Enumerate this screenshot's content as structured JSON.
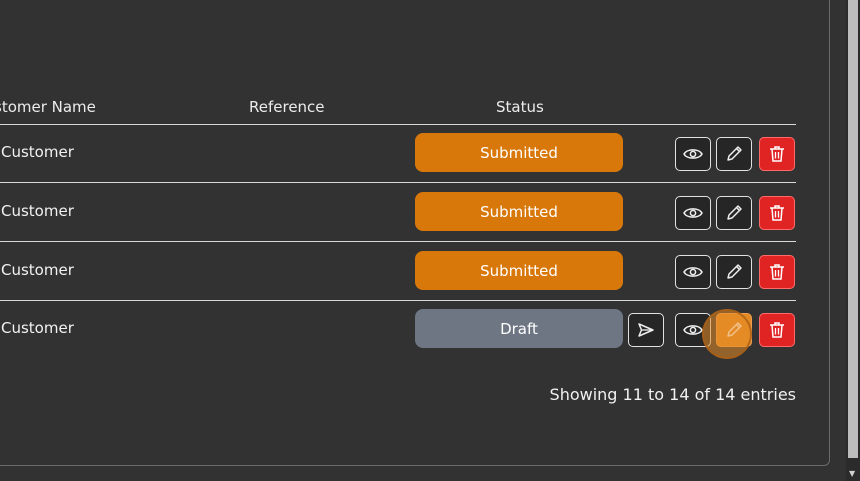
{
  "table": {
    "headers": {
      "customer_name": "stomer Name",
      "reference": "Reference",
      "status": "Status"
    },
    "rows": [
      {
        "customer": "Customer",
        "reference": "",
        "status": "Submitted"
      },
      {
        "customer": "Customer",
        "reference": "",
        "status": "Submitted"
      },
      {
        "customer": "Customer",
        "reference": "",
        "status": "Submitted"
      },
      {
        "customer": "Customer",
        "reference": "",
        "status": "Draft"
      }
    ]
  },
  "footer": {
    "entries_info": "Showing 11 to 14 of 14 entries"
  },
  "icons": {
    "view": "eye-icon",
    "edit": "pencil-icon",
    "delete": "trash-icon",
    "send": "send-icon"
  },
  "colors": {
    "background": "#323232",
    "submitted": "#d9780a",
    "draft": "#6e7684",
    "delete": "#e02424",
    "edit_hover": "#e28a23"
  }
}
